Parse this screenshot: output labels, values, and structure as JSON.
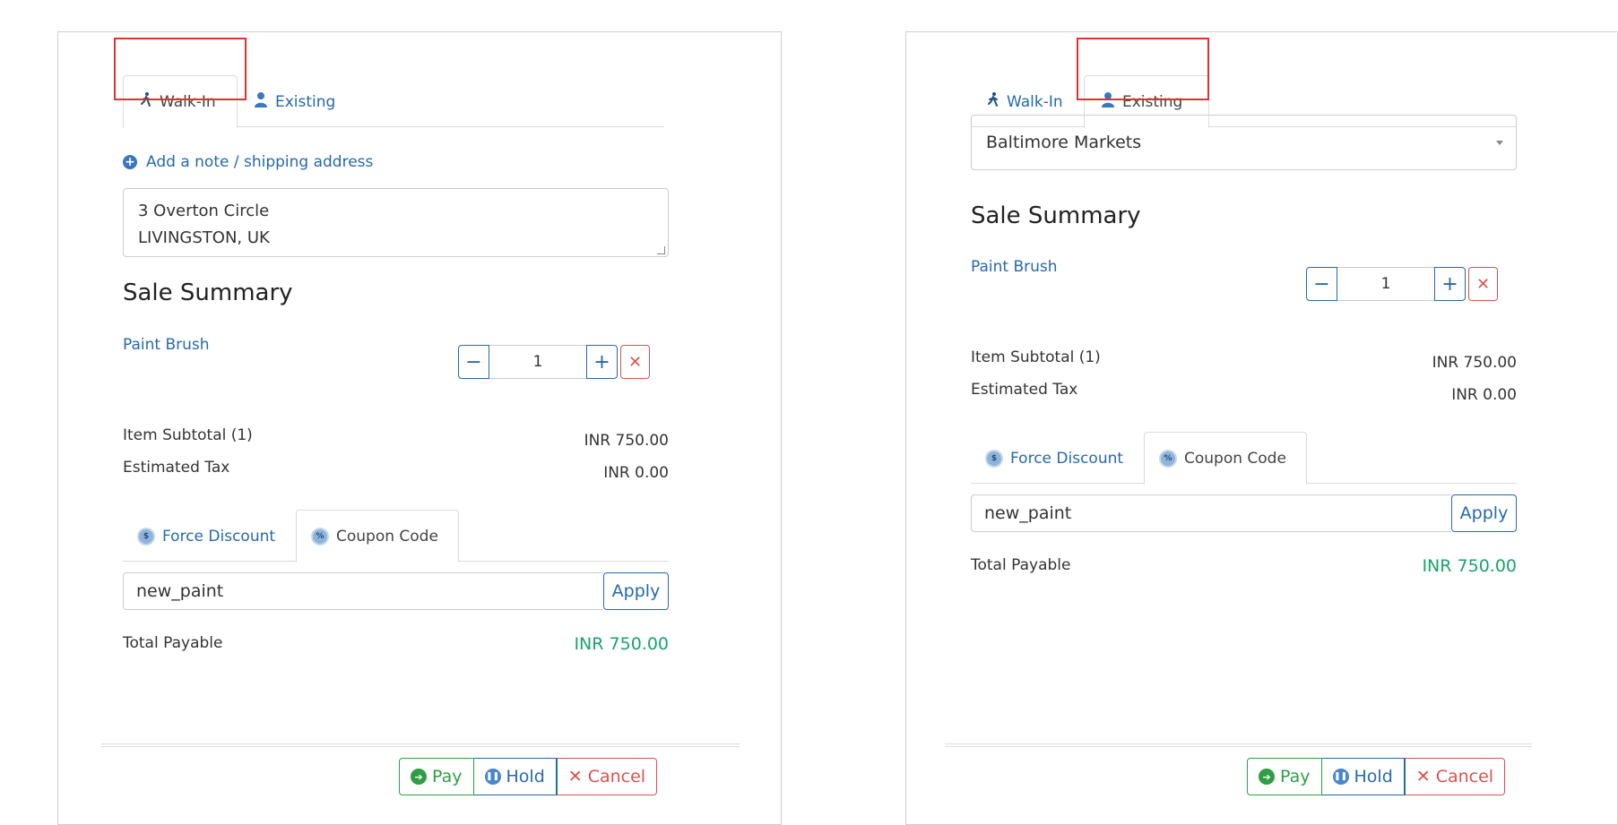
{
  "walkin_panel": {
    "tabs": {
      "walkin": "Walk-In",
      "existing": "Existing"
    },
    "add_note": "Add a note / shipping address",
    "address_line1": "3 Overton Circle",
    "address_line2": "LIVINGSTON, UK",
    "sale_summary": "Sale Summary",
    "item_name": "Paint Brush",
    "quantity": "1",
    "item_subtotal_label": "Item Subtotal (1)",
    "item_subtotal_value": "INR 750.00",
    "estimated_tax_label": "Estimated Tax",
    "estimated_tax_value": "INR 0.00",
    "discount_tabs": {
      "force": "Force Discount",
      "coupon": "Coupon Code"
    },
    "coupon_value": "new_paint",
    "apply_label": "Apply",
    "total_label": "Total Payable",
    "total_value": "INR 750.00",
    "actions": {
      "pay": "Pay",
      "hold": "Hold",
      "cancel": "Cancel"
    }
  },
  "existing_panel": {
    "tabs": {
      "walkin": "Walk-In",
      "existing": "Existing"
    },
    "customer_selected": "Baltimore Markets",
    "sale_summary": "Sale Summary",
    "item_name": "Paint Brush",
    "quantity": "1",
    "item_subtotal_label": "Item Subtotal (1)",
    "item_subtotal_value": "INR 750.00",
    "estimated_tax_label": "Estimated Tax",
    "estimated_tax_value": "INR 0.00",
    "discount_tabs": {
      "force": "Force Discount",
      "coupon": "Coupon Code"
    },
    "coupon_value": "new_paint",
    "apply_label": "Apply",
    "total_label": "Total Payable",
    "total_value": "INR 750.00",
    "actions": {
      "pay": "Pay",
      "hold": "Hold",
      "cancel": "Cancel"
    }
  },
  "icons": {
    "walk": "walking-person-icon",
    "user": "user-icon",
    "plus_circle": "plus-circle-icon",
    "discount": "discount-badge-icon",
    "pay": "arrow-right-circle-icon",
    "hold": "pause-circle-icon",
    "cancel": "close-icon"
  },
  "colors": {
    "link": "#2569ad",
    "success": "#1aa36b",
    "danger": "#d9534f",
    "highlight": "#e03131"
  }
}
